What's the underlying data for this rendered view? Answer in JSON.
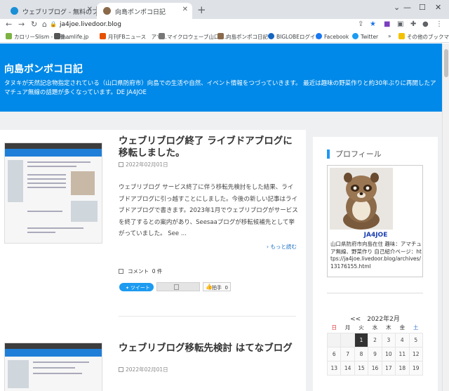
{
  "browser": {
    "tabs": [
      {
        "title": "ウェブリブログ - 無料のブログ(blog)サ",
        "active": false,
        "favicon_color": "#1a8fd6"
      },
      {
        "title": "向島ポンポコ日記",
        "active": true,
        "favicon_color": "#8a6a4a"
      }
    ],
    "url": "ja4joe.livedoor.blog",
    "bookmarks": [
      {
        "label": "カロリーSlism - 栄養...",
        "icon_color": "#7cb342"
      },
      {
        "label": "hamlife.jp",
        "icon_color": "#555555"
      },
      {
        "label": "月刊FBニュース　アマ...",
        "icon_color": "#e65100"
      },
      {
        "label": "マイクロウェーブ山口 -...",
        "icon_color": "#777777"
      },
      {
        "label": "向島ポンポコ日記",
        "icon_color": "#8a6a4a"
      },
      {
        "label": "BIGLOBEログイン",
        "icon_color": "#1565c0"
      },
      {
        "label": "Facebook",
        "icon_color": "#1877f2"
      },
      {
        "label": "Twitter",
        "icon_color": "#1d9bf0"
      }
    ],
    "more_bookmarks": "»",
    "other_bookmarks": "その他のブックマーク"
  },
  "site": {
    "title": "向島ポンポコ日記",
    "description": "タヌキが天然記念物指定されている（山口県防府市）向島での生活や自然、イベント情報をつづっていきます。 最近は趣味の野菜作りと約30年ぶりに再開したアマチュア無線の話題が多くなっています。DE JA4JOE"
  },
  "posts": [
    {
      "title": "ウェブリブログ終了 ライブドアブログに移転しました。",
      "date": "2022年02月01日",
      "body": "ウェブリブログ サービス終了に伴う移転先検討をした結果、ライブドアブログに引っ越すことにしました。今後の新しい記事はライブドアブログで書きます。2023年1月でウェブリブログがサービスを終了するとの案内があり、Seesaaブログが移転候補先として挙がっていました。 See ...",
      "more": "もっと読む",
      "comment_label": "コメント",
      "comment_count": "0 件",
      "tweet_label": "ツイート",
      "like_label": "拍手",
      "like_count": "0"
    },
    {
      "title": "ウェブリブログ移転先検討 はてなブログ",
      "date": "2022年02月01日"
    }
  ],
  "sidebar": {
    "profile_heading": "プロフィール",
    "profile_name": "JA4JOE",
    "profile_text": "山口県防府市向島在住 趣味：アマチュア無線、野菜作り 自己紹介ページ：https://ja4joe.livedoor.blog/archives/13176155.html",
    "calendar": {
      "title": "<<　2022年2月",
      "weekdays": [
        "日",
        "月",
        "火",
        "水",
        "木",
        "金",
        "土"
      ],
      "rows": [
        [
          "",
          "",
          "1",
          "2",
          "3",
          "4",
          "5"
        ],
        [
          "6",
          "7",
          "8",
          "9",
          "10",
          "11",
          "12"
        ],
        [
          "13",
          "14",
          "15",
          "16",
          "17",
          "18",
          "19"
        ]
      ],
      "today": "1"
    }
  }
}
